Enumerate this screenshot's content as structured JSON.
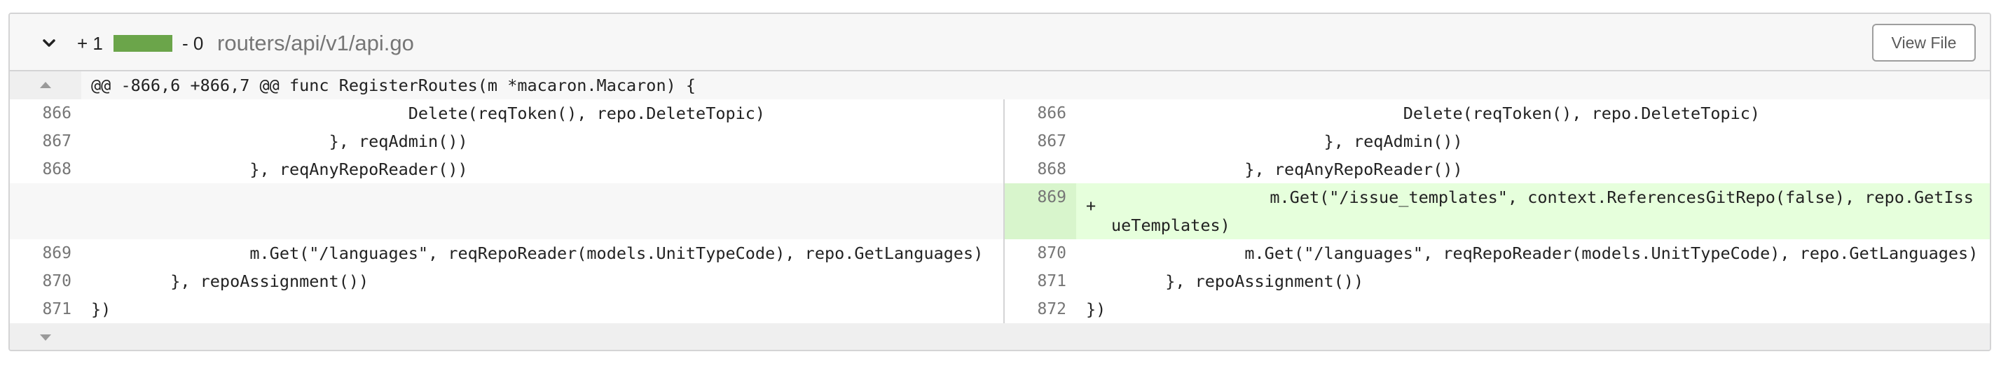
{
  "file": {
    "additions": "+ 1",
    "deletions": "- 0",
    "name": "routers/api/v1/api.go",
    "view_button": "View File"
  },
  "hunk_header": "@@ -866,6 +866,7 @@ func RegisterRoutes(m *macaron.Macaron) {",
  "lines": [
    {
      "left_num": "866",
      "left_code": "\t\t\t\tDelete(reqToken(), repo.DeleteTopic)",
      "right_num": "866",
      "right_code": "\t\t\t\tDelete(reqToken(), repo.DeleteTopic)"
    },
    {
      "left_num": "867",
      "left_code": "\t\t\t}, reqAdmin())",
      "right_num": "867",
      "right_code": "\t\t\t}, reqAdmin())"
    },
    {
      "left_num": "868",
      "left_code": "\t\t}, reqAnyRepoReader())",
      "right_num": "868",
      "right_code": "\t\t}, reqAnyRepoReader())"
    },
    {
      "right_num": "869",
      "sign": "+",
      "right_code": "\t\tm.Get(\"/issue_templates\", context.ReferencesGitRepo(false), repo.GetIssueTemplates)"
    },
    {
      "left_num": "869",
      "left_code": "\t\tm.Get(\"/languages\", reqRepoReader(models.UnitTypeCode), repo.GetLanguages)",
      "right_num": "870",
      "right_code": "\t\tm.Get(\"/languages\", reqRepoReader(models.UnitTypeCode), repo.GetLanguages)"
    },
    {
      "left_num": "870",
      "left_code": "\t}, repoAssignment())",
      "right_num": "871",
      "right_code": "\t}, repoAssignment())"
    },
    {
      "left_num": "871",
      "left_code": "})",
      "right_num": "872",
      "right_code": "})"
    }
  ],
  "colors": {
    "added_bar": "#6ba54a",
    "added_line_bg": "#e6ffdc",
    "added_num_bg": "#d8f5cc",
    "hunk_bg": "#f7f7f7"
  },
  "icons": {
    "collapse": "chevron-down-icon",
    "expand_up": "expand-up-icon",
    "expand_down": "expand-down-icon"
  }
}
